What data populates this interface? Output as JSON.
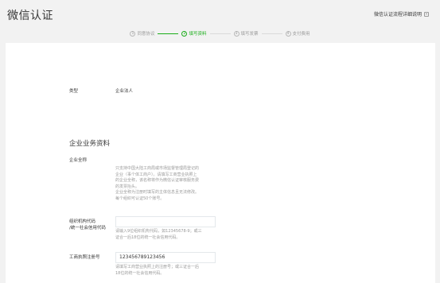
{
  "header": {
    "title": "微信认证",
    "help_link": "微信认证流程详细说明"
  },
  "steps": [
    {
      "num": "1",
      "label": "同意协议",
      "active": false
    },
    {
      "num": "2",
      "label": "填写资料",
      "active": true
    },
    {
      "num": "3",
      "label": "填写发票",
      "active": false
    },
    {
      "num": "4",
      "label": "支付费用",
      "active": false
    }
  ],
  "form": {
    "type_label": "类型",
    "type_value": "企业法人",
    "section_title": "企业业务资料",
    "company_name_label": "企业全称",
    "company_name_notes": [
      "只支持中国大陆工商局或市场监督管理局登记的",
      "企业（事个体工商户）。请填写工商营业执照上",
      "的企业全称，该名称将作为微信认证审核服务费",
      "的发票抬头。",
      "企业全称为注册时填写的主体信息且无法修改。",
      "每个组织可认证50个账号。"
    ],
    "org_code_label_line1": "组织机构代码",
    "org_code_label_line2": "/统一社会信用代码",
    "org_code_value": "",
    "org_code_notes": [
      "请输入9位组织机构代码，如12345678-9；或三",
      "证合一后18位的统一社会信用代码。"
    ],
    "reg_no_label": "工商执照注册号",
    "reg_no_value": "123456789123456",
    "reg_no_notes": [
      "请填写工商营业执照上的注册号；或三证合一后",
      "18位的统一社会信用代码。"
    ]
  }
}
